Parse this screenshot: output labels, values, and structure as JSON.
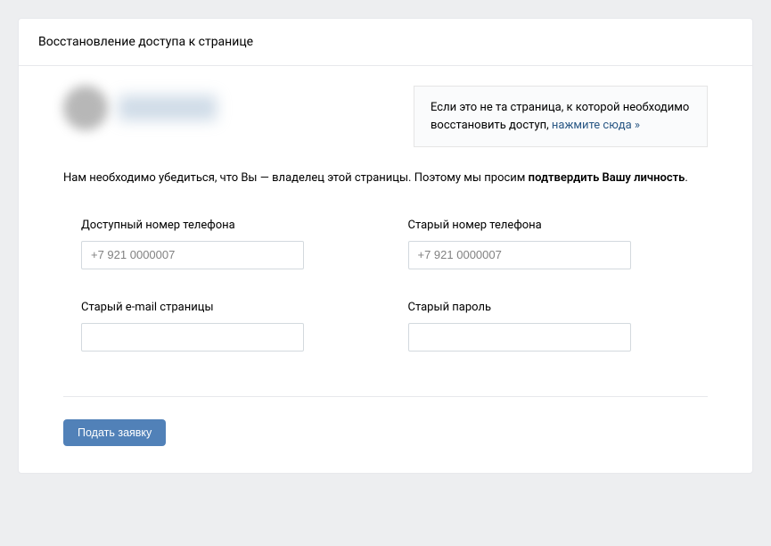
{
  "header": {
    "title": "Восстановление доступа к странице"
  },
  "notice": {
    "text_prefix": "Если это не та страница, к которой необходимо восстановить доступ, ",
    "link_text": "нажмите сюда »"
  },
  "description": {
    "text_prefix": "Нам необходимо убедиться, что Вы — владелец этой страницы. Поэтому мы просим ",
    "bold_text": "подтвердить Вашу личность",
    "text_suffix": "."
  },
  "form": {
    "available_phone": {
      "label": "Доступный номер телефона",
      "placeholder": "+7 921 0000007",
      "value": ""
    },
    "old_phone": {
      "label": "Старый номер телефона",
      "placeholder": "+7 921 0000007",
      "value": ""
    },
    "old_email": {
      "label": "Старый e-mail страницы",
      "placeholder": "",
      "value": ""
    },
    "old_password": {
      "label": "Старый пароль",
      "placeholder": "",
      "value": ""
    },
    "submit_label": "Подать заявку"
  }
}
